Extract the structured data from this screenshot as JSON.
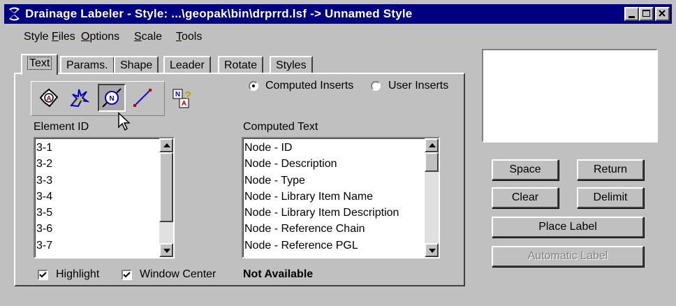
{
  "window": {
    "title": "Drainage Labeler - Style: ...\\geopak\\bin\\drprrd.lsf -> Unnamed Style"
  },
  "menu": {
    "items": [
      {
        "pre": "Style ",
        "u": "F",
        "post": "iles"
      },
      {
        "pre": "",
        "u": "O",
        "post": "ptions"
      },
      {
        "pre": "",
        "u": "S",
        "post": "cale"
      },
      {
        "pre": "",
        "u": "T",
        "post": "ools"
      }
    ]
  },
  "tabs": [
    {
      "label": "Text",
      "active": true
    },
    {
      "label": "Params.",
      "active": false
    },
    {
      "label": "Shape",
      "active": false
    },
    {
      "label": "Leader",
      "active": false
    },
    {
      "label": "Rotate",
      "active": false
    },
    {
      "label": "Styles",
      "active": false
    }
  ],
  "tools": [
    {
      "icon": "area-icon",
      "pressed": false
    },
    {
      "icon": "splash-icon",
      "pressed": false
    },
    {
      "icon": "node-icon",
      "pressed": true
    },
    {
      "icon": "link-icon",
      "pressed": false
    }
  ],
  "inserts": {
    "computed_label": "Computed Inserts",
    "user_label": "User Inserts",
    "selected": "computed"
  },
  "element_id": {
    "label": "Element ID",
    "items": [
      "3-1",
      "3-2",
      "3-3",
      "3-4",
      "3-5",
      "3-6",
      "3-7"
    ]
  },
  "computed_text": {
    "label": "Computed Text",
    "items": [
      "Node - ID",
      "Node - Description",
      "Node - Type",
      "Node - Library Item Name",
      "Node - Library Item Description",
      "Node - Reference Chain",
      "Node - Reference PGL"
    ]
  },
  "options": {
    "highlight_label": "Highlight",
    "highlight_checked": true,
    "window_center_label": "Window Center",
    "window_center_checked": true,
    "status": "Not Available"
  },
  "buttons": {
    "space": "Space",
    "return": "Return",
    "clear": "Clear",
    "delimit": "Delimit",
    "place_label": "Place Label",
    "automatic_label": "Automatic Label"
  }
}
